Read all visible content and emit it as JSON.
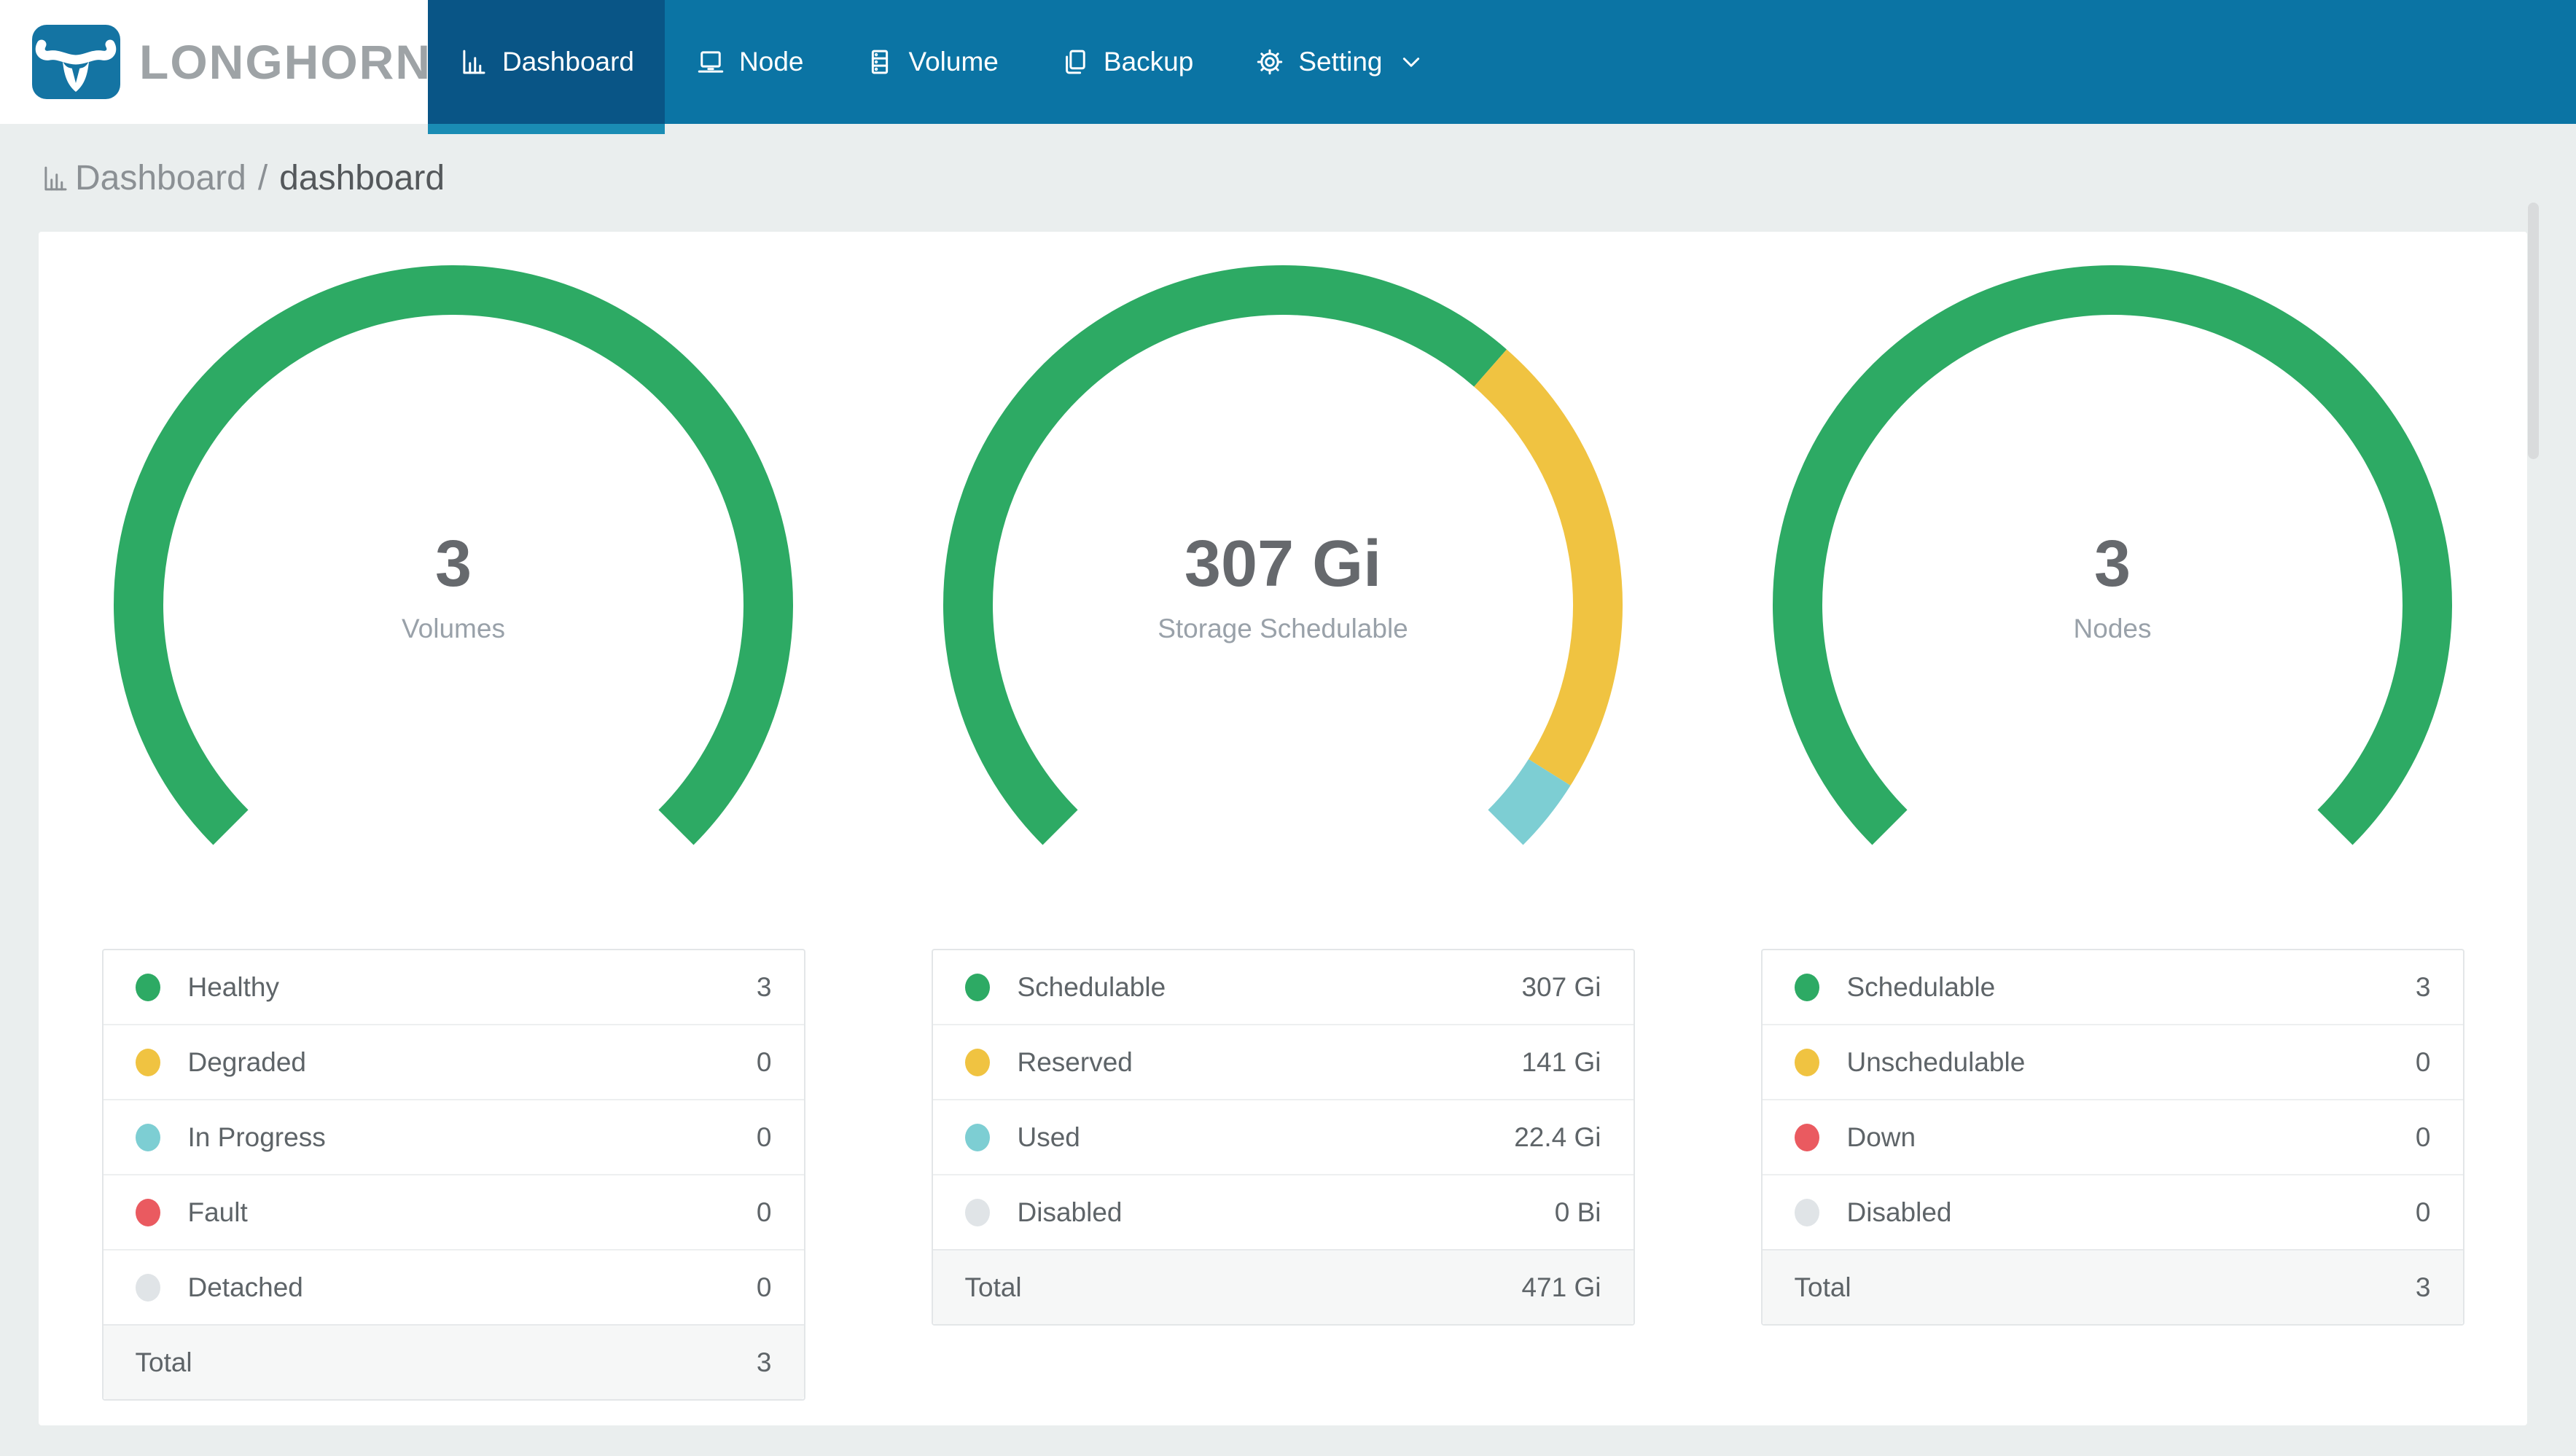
{
  "colors": {
    "navbar_bg": "#0B74A4",
    "navbar_active_bg": "#095586",
    "navbar_active_strip": "#1A8CB4",
    "green": "#2DAA64",
    "yellow": "#F0C341",
    "teal": "#7DCED3",
    "red": "#EA5A60",
    "gray": "#E0E4E7"
  },
  "brand": {
    "name": "LONGHORN",
    "logo_icon": "bull-icon"
  },
  "navbar": {
    "items": [
      {
        "label": "Dashboard",
        "icon": "bar-chart-icon",
        "active": true,
        "caret": false
      },
      {
        "label": "Node",
        "icon": "node-icon",
        "active": false,
        "caret": false
      },
      {
        "label": "Volume",
        "icon": "volume-icon",
        "active": false,
        "caret": false
      },
      {
        "label": "Backup",
        "icon": "backup-icon",
        "active": false,
        "caret": false
      },
      {
        "label": "Setting",
        "icon": "gear-icon",
        "active": false,
        "caret": true
      }
    ]
  },
  "breadcrumb": {
    "icon": "bar-chart-icon",
    "parent": "Dashboard",
    "separator": "/",
    "current": "dashboard"
  },
  "panels": [
    {
      "id": "volumes",
      "center_value": "3",
      "center_label": "Volumes",
      "rows": [
        {
          "label": "Healthy",
          "color": "green",
          "value": "3",
          "amount": 3
        },
        {
          "label": "Degraded",
          "color": "yellow",
          "value": "0",
          "amount": 0
        },
        {
          "label": "In Progress",
          "color": "teal",
          "value": "0",
          "amount": 0
        },
        {
          "label": "Fault",
          "color": "red",
          "value": "0",
          "amount": 0
        },
        {
          "label": "Detached",
          "color": "gray",
          "value": "0",
          "amount": 0
        }
      ],
      "total": {
        "label": "Total",
        "value": "3"
      }
    },
    {
      "id": "storage-schedulable",
      "center_value": "307 Gi",
      "center_label": "Storage Schedulable",
      "rows": [
        {
          "label": "Schedulable",
          "color": "green",
          "value": "307 Gi",
          "amount": 307
        },
        {
          "label": "Reserved",
          "color": "yellow",
          "value": "141 Gi",
          "amount": 141
        },
        {
          "label": "Used",
          "color": "teal",
          "value": "22.4 Gi",
          "amount": 22.4
        },
        {
          "label": "Disabled",
          "color": "gray",
          "value": "0 Bi",
          "amount": 0
        }
      ],
      "total": {
        "label": "Total",
        "value": "471 Gi"
      }
    },
    {
      "id": "nodes",
      "center_value": "3",
      "center_label": "Nodes",
      "rows": [
        {
          "label": "Schedulable",
          "color": "green",
          "value": "3",
          "amount": 3
        },
        {
          "label": "Unschedulable",
          "color": "yellow",
          "value": "0",
          "amount": 0
        },
        {
          "label": "Down",
          "color": "red",
          "value": "0",
          "amount": 0
        },
        {
          "label": "Disabled",
          "color": "gray",
          "value": "0",
          "amount": 0
        }
      ],
      "total": {
        "label": "Total",
        "value": "3"
      }
    }
  ],
  "chart_data": [
    {
      "type": "gauge",
      "title": "Volumes",
      "center_text": "3",
      "sweep_deg": 270,
      "segments": [
        {
          "label": "Healthy",
          "value": 3,
          "color": "#2DAA64"
        },
        {
          "label": "Degraded",
          "value": 0,
          "color": "#F0C341"
        },
        {
          "label": "In Progress",
          "value": 0,
          "color": "#7DCED3"
        },
        {
          "label": "Fault",
          "value": 0,
          "color": "#EA5A60"
        },
        {
          "label": "Detached",
          "value": 0,
          "color": "#E0E4E7"
        }
      ],
      "total": 3
    },
    {
      "type": "gauge",
      "title": "Storage Schedulable",
      "center_text": "307 Gi",
      "sweep_deg": 270,
      "segments": [
        {
          "label": "Schedulable",
          "value": 307,
          "color": "#2DAA64"
        },
        {
          "label": "Reserved",
          "value": 141,
          "color": "#F0C341"
        },
        {
          "label": "Used",
          "value": 22.4,
          "color": "#7DCED3"
        },
        {
          "label": "Disabled",
          "value": 0,
          "color": "#E0E4E7"
        }
      ],
      "total": 470.4
    },
    {
      "type": "gauge",
      "title": "Nodes",
      "center_text": "3",
      "sweep_deg": 270,
      "segments": [
        {
          "label": "Schedulable",
          "value": 3,
          "color": "#2DAA64"
        },
        {
          "label": "Unschedulable",
          "value": 0,
          "color": "#F0C341"
        },
        {
          "label": "Down",
          "value": 0,
          "color": "#EA5A60"
        },
        {
          "label": "Disabled",
          "value": 0,
          "color": "#E0E4E7"
        }
      ],
      "total": 3
    }
  ]
}
